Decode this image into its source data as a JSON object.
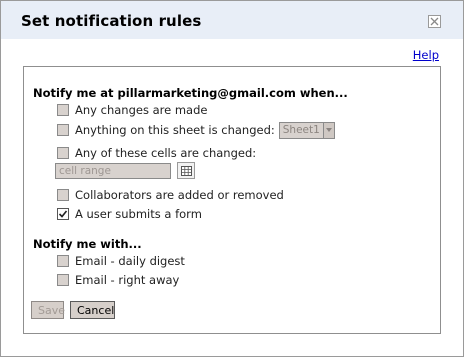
{
  "dialog": {
    "title": "Set notification rules",
    "help_label": "Help"
  },
  "notify_when": {
    "heading": "Notify me at pillarmarketing@gmail.com when...",
    "options": [
      {
        "label": "Any changes are made",
        "checked": false
      },
      {
        "label": "Anything on this sheet is changed:",
        "checked": false
      },
      {
        "label": "Any of these cells are changed:",
        "checked": false
      },
      {
        "label": "Collaborators are added or removed",
        "checked": false
      },
      {
        "label": "A user submits a form",
        "checked": true
      }
    ],
    "sheet_select": {
      "selected": "Sheet1"
    },
    "cell_range": {
      "placeholder": "cell range",
      "value": ""
    }
  },
  "notify_with": {
    "heading": "Notify me with...",
    "options": [
      {
        "label": "Email - daily digest",
        "checked": false
      },
      {
        "label": "Email - right away",
        "checked": false
      }
    ]
  },
  "buttons": {
    "save_label": "Save",
    "cancel_label": "Cancel"
  },
  "icons": {
    "close": "close-icon",
    "dropdown": "chevron-down-icon",
    "range_picker": "grid-icon",
    "check": "check-icon"
  }
}
